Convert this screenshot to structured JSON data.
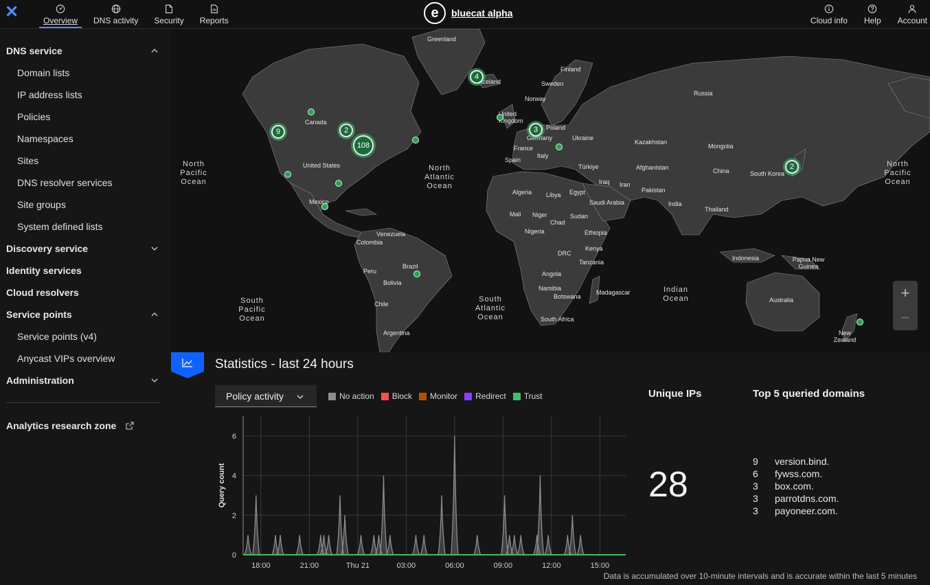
{
  "header": {
    "close_icon": "close-icon",
    "nav": [
      {
        "label": "Overview",
        "icon": "dashboard-icon",
        "active": true
      },
      {
        "label": "DNS activity",
        "icon": "globe-icon"
      },
      {
        "label": "Security",
        "icon": "document-shield-icon"
      },
      {
        "label": "Reports",
        "icon": "report-icon"
      }
    ],
    "brand_logo": "e",
    "brand_name": "bluecat alpha",
    "right": [
      {
        "label": "Cloud info",
        "icon": "info-icon"
      },
      {
        "label": "Help",
        "icon": "help-icon"
      },
      {
        "label": "Account",
        "icon": "user-icon"
      }
    ]
  },
  "sidebar": {
    "dns_service": "DNS service",
    "dns_items": [
      "Domain lists",
      "IP address lists",
      "Policies",
      "Namespaces",
      "Sites",
      "DNS resolver services",
      "Site groups",
      "System defined lists"
    ],
    "discovery_service": "Discovery service",
    "identity_services": "Identity services",
    "cloud_resolvers": "Cloud resolvers",
    "service_points": "Service points",
    "sp_items": [
      "Service points (v4)",
      "Anycast VIPs overview"
    ],
    "administration": "Administration",
    "analytics": "Analytics research zone"
  },
  "map": {
    "labels": [
      {
        "text": "Greenland"
      },
      {
        "text": "Iceland"
      },
      {
        "text": "Canada"
      },
      {
        "text": "United States"
      },
      {
        "text": "Mexico"
      },
      {
        "text": "Venezuela"
      },
      {
        "text": "Colombia"
      },
      {
        "text": "Brazil"
      },
      {
        "text": "Peru"
      },
      {
        "text": "Bolivia"
      },
      {
        "text": "Chile"
      },
      {
        "text": "Argentina"
      },
      {
        "text": "Finland"
      },
      {
        "text": "Sweden"
      },
      {
        "text": "Norway"
      },
      {
        "text": "United Kingdom"
      },
      {
        "text": "Poland"
      },
      {
        "text": "Germany"
      },
      {
        "text": "France"
      },
      {
        "text": "Spain"
      },
      {
        "text": "Italy"
      },
      {
        "text": "Ukraine"
      },
      {
        "text": "Russia"
      },
      {
        "text": "Kazakhstan"
      },
      {
        "text": "Mongolia"
      },
      {
        "text": "China"
      },
      {
        "text": "South Korea"
      },
      {
        "text": "Türkiye"
      },
      {
        "text": "Iraq"
      },
      {
        "text": "Iran"
      },
      {
        "text": "Afghanistan"
      },
      {
        "text": "Pakistan"
      },
      {
        "text": "India"
      },
      {
        "text": "Thailand"
      },
      {
        "text": "Indonesia"
      },
      {
        "text": "Papua New Guinea"
      },
      {
        "text": "Australia"
      },
      {
        "text": "New Zealand"
      },
      {
        "text": "Algeria"
      },
      {
        "text": "Libya"
      },
      {
        "text": "Egypt"
      },
      {
        "text": "Saudi Arabia"
      },
      {
        "text": "Mali"
      },
      {
        "text": "Niger"
      },
      {
        "text": "Chad"
      },
      {
        "text": "Sudan"
      },
      {
        "text": "Nigeria"
      },
      {
        "text": "Ethiopia"
      },
      {
        "text": "Kenya"
      },
      {
        "text": "DRC"
      },
      {
        "text": "Tanzania"
      },
      {
        "text": "Angola"
      },
      {
        "text": "Namibia"
      },
      {
        "text": "Botswana"
      },
      {
        "text": "Madagascar"
      },
      {
        "text": "South Africa"
      }
    ],
    "oceans": [
      {
        "text": "North\nPacific\nOcean"
      },
      {
        "text": "North\nAtlantic\nOcean"
      },
      {
        "text": "North\nPacific\nOcean"
      },
      {
        "text": "South\nPacific\nOcean"
      },
      {
        "text": "South\nAtlantic\nOcean"
      },
      {
        "text": "Indian\nOcean"
      }
    ],
    "clusters": [
      {
        "count": "4"
      },
      {
        "count": "9"
      },
      {
        "count": "2"
      },
      {
        "count": "108"
      },
      {
        "count": "3"
      },
      {
        "count": "2"
      }
    ],
    "zoom_in": "+",
    "zoom_out": "−"
  },
  "stats": {
    "title": "Statistics - last 24 hours",
    "select_value": "Policy activity",
    "legend": [
      {
        "label": "No action",
        "color": "#8d8d8d"
      },
      {
        "label": "Block",
        "color": "#fa4d56"
      },
      {
        "label": "Monitor",
        "color": "#ba4e00"
      },
      {
        "label": "Redirect",
        "color": "#8a3ffc"
      },
      {
        "label": "Trust",
        "color": "#42be65"
      }
    ],
    "unique_title": "Unique IPs",
    "unique_value": "28",
    "top5_title": "Top 5 queried domains",
    "top5": [
      {
        "count": "9",
        "domain": "version.bind."
      },
      {
        "count": "6",
        "domain": "fywss.com."
      },
      {
        "count": "3",
        "domain": "box.com."
      },
      {
        "count": "3",
        "domain": "parrotdns.com."
      },
      {
        "count": "3",
        "domain": "payoneer.com."
      }
    ],
    "footnote": "Data is accumulated over 10-minute intervals and is accurate within the last 5 minutes"
  },
  "chart_data": {
    "type": "area",
    "ylabel": "Query count",
    "ylim": [
      0,
      7
    ],
    "yticks": [
      0,
      2,
      4,
      6
    ],
    "xticks": [
      "18:00",
      "21:00",
      "Thu 21",
      "03:00",
      "06:00",
      "09:00",
      "12:00",
      "15:00"
    ],
    "x_hours_start": 16.9,
    "x_hours_end": 40.6,
    "series": [
      {
        "name": "No action",
        "color": "#8d8d8d",
        "peaks": [
          [
            17.2,
            1
          ],
          [
            17.7,
            3
          ],
          [
            18.9,
            1
          ],
          [
            19.2,
            1
          ],
          [
            20.4,
            1
          ],
          [
            21.7,
            1
          ],
          [
            21.9,
            1
          ],
          [
            22.2,
            1
          ],
          [
            22.9,
            3
          ],
          [
            23.2,
            2
          ],
          [
            24.2,
            1
          ],
          [
            25.0,
            1
          ],
          [
            25.3,
            1
          ],
          [
            25.6,
            4
          ],
          [
            26.0,
            1
          ],
          [
            27.6,
            1
          ],
          [
            28.1,
            1
          ],
          [
            29.2,
            3
          ],
          [
            30.0,
            6
          ],
          [
            31.4,
            1
          ],
          [
            33.1,
            3
          ],
          [
            33.4,
            1
          ],
          [
            33.7,
            1
          ],
          [
            34.1,
            1
          ],
          [
            35.1,
            1
          ],
          [
            35.3,
            4
          ],
          [
            35.8,
            1
          ],
          [
            37.0,
            1
          ],
          [
            37.3,
            2
          ],
          [
            37.8,
            1
          ]
        ]
      },
      {
        "name": "Trust",
        "color": "#42be65",
        "baseline": 0
      }
    ]
  }
}
